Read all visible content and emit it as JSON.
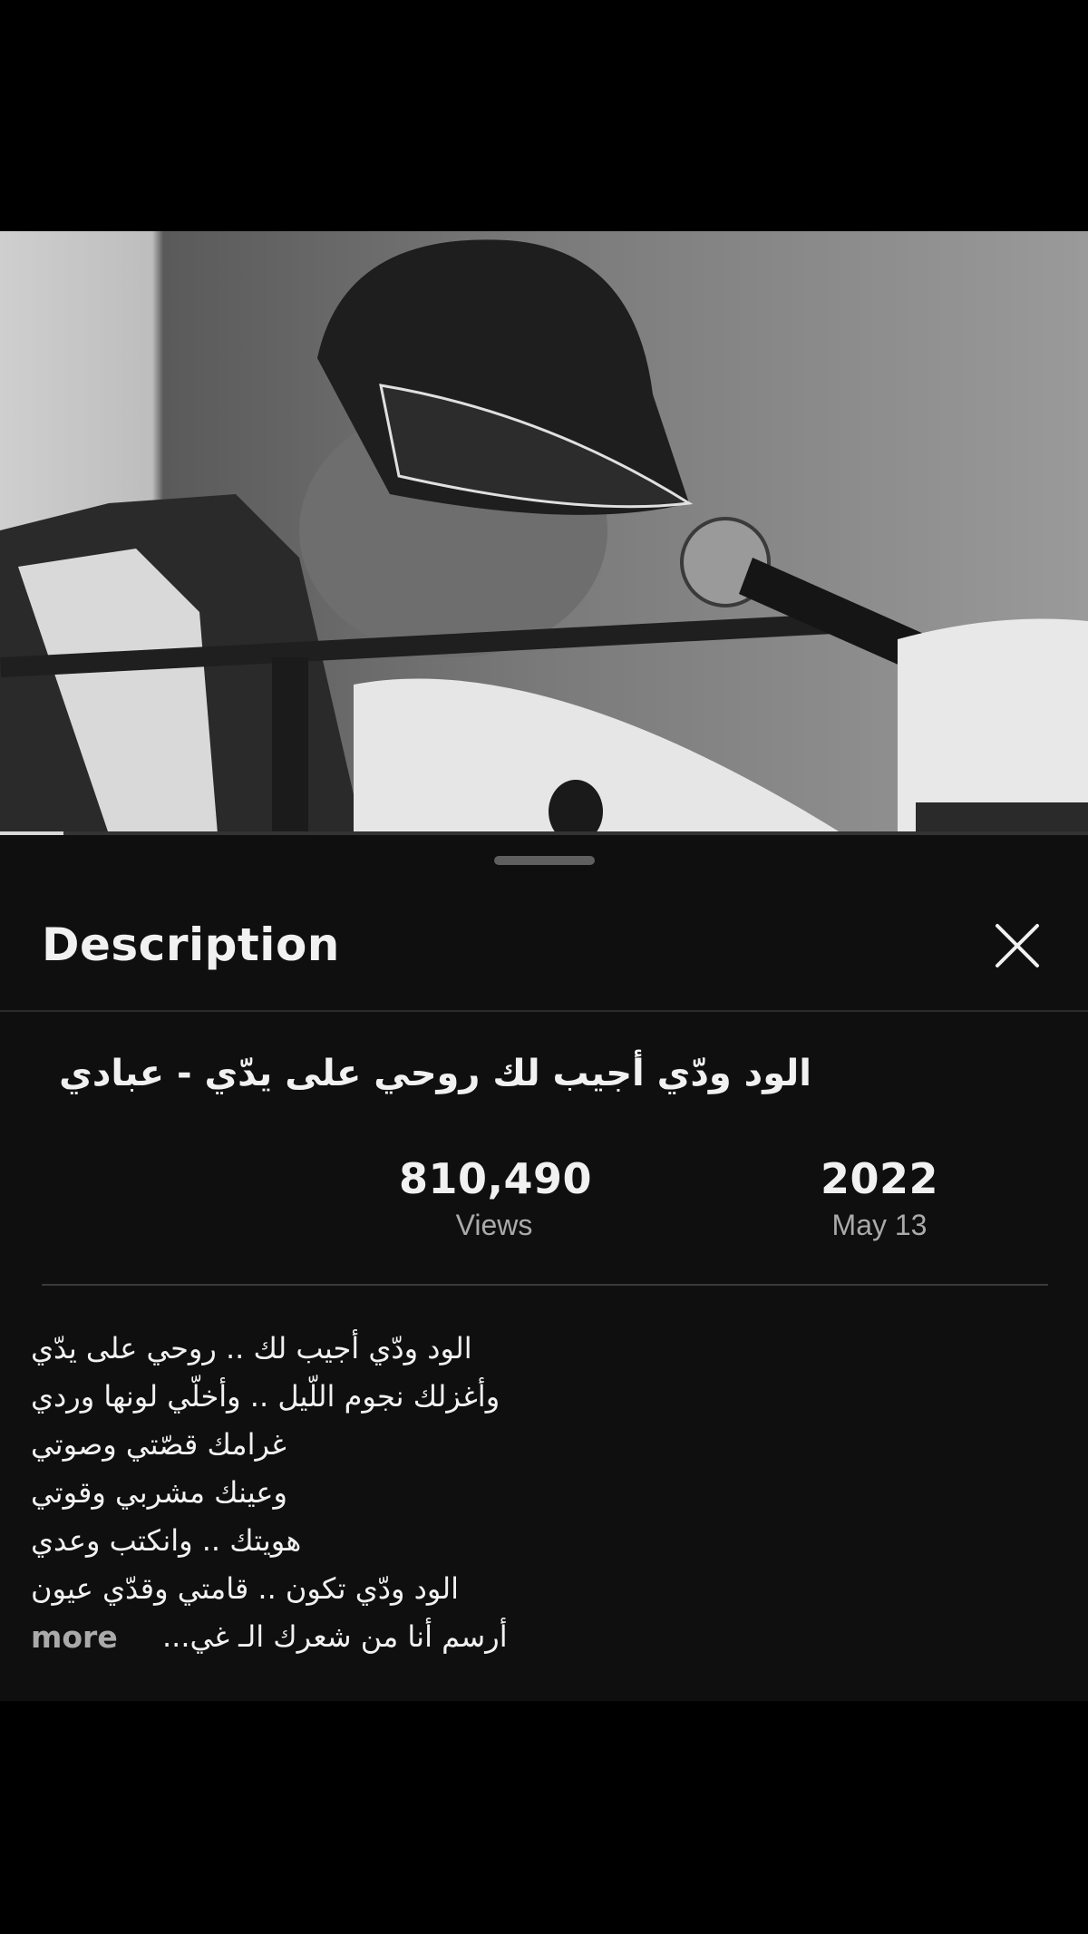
{
  "video": {
    "progress_fraction": 0.058
  },
  "sheet": {
    "title": "Description",
    "close_icon": "close-icon",
    "video_title": "الود ودّي أجيب لك روحي على يدّي - عبادي",
    "stats": {
      "views_value": "810,490",
      "views_label": "Views",
      "year": "2022",
      "date": "May 13"
    },
    "lyrics": [
      "الود ودّي أجيب لك .. روحي على يدّي",
      "وأغزلك نجوم اللّيل .. وأخلّي لونها وردي",
      "غرامك قصّتي وصوتي",
      "وعينك مشربي وقوتي",
      "هويتك .. وانكتب وعدي",
      "الود ودّي تكون .. قامتي وقدّي عيون"
    ],
    "last_line": "أرسم أنا من شعرك الـ غي...",
    "more_label": "more"
  }
}
